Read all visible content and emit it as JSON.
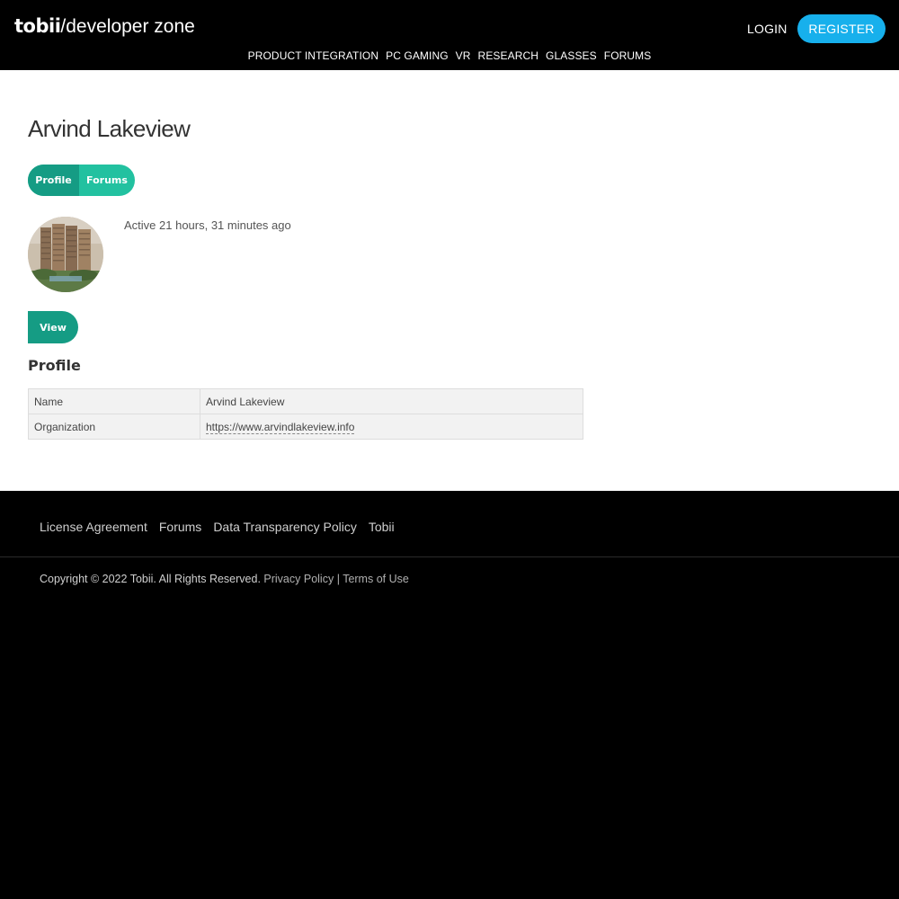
{
  "header": {
    "logo_brand": "tobii",
    "logo_zone": "/developer zone",
    "login_label": "LOGIN",
    "register_label": "REGISTER",
    "nav": [
      {
        "label": "PRODUCT INTEGRATION"
      },
      {
        "label": "PC GAMING"
      },
      {
        "label": "VR"
      },
      {
        "label": "RESEARCH"
      },
      {
        "label": "GLASSES"
      },
      {
        "label": "FORUMS"
      }
    ]
  },
  "profile_page": {
    "title": "Arvind Lakeview",
    "tabs": {
      "profile": "Profile",
      "forums": "Forums"
    },
    "active_text": "Active 21 hours, 31 minutes ago",
    "view_button": "View",
    "section_title": "Profile",
    "fields": [
      {
        "key": "Name",
        "value": "Arvind Lakeview"
      },
      {
        "key": "Organization",
        "value": "https://www.arvindlakeview.info"
      }
    ]
  },
  "footer": {
    "links": [
      {
        "label": "License Agreement"
      },
      {
        "label": "Forums"
      },
      {
        "label": "Data Transparency Policy"
      },
      {
        "label": "Tobii"
      }
    ],
    "copyright_text": "Copyright © 2022 Tobii. All Rights Reserved.",
    "privacy_label": "Privacy Policy",
    "separator": "|",
    "terms_label": "Terms of Use"
  },
  "colors": {
    "brand_accent": "#17b0ec",
    "tab_active": "#159c84",
    "tab_inactive": "#22c1a0"
  },
  "icons": {
    "avatar": "building-photo-avatar"
  }
}
